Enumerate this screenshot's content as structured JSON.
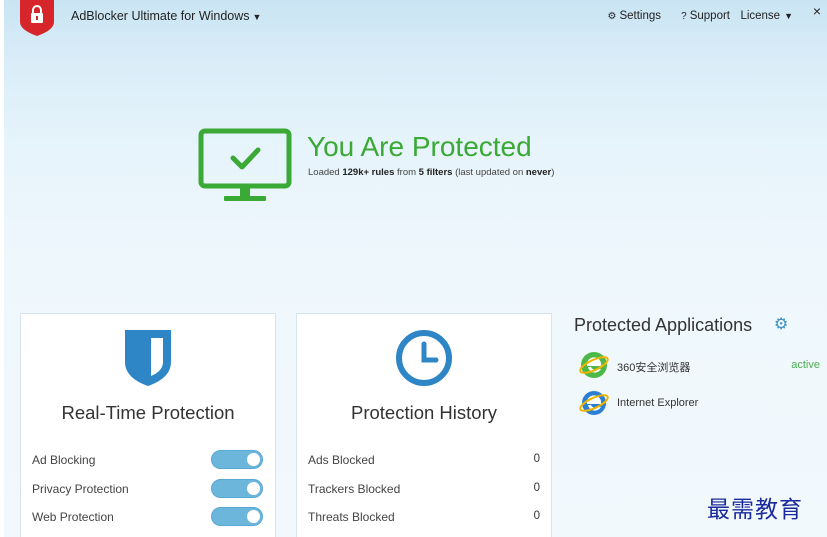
{
  "header": {
    "app_title": "AdBlocker Ultimate for Windows",
    "settings_label": "Settings",
    "support_label": "Support",
    "license_label": "License",
    "close_glyph": "×"
  },
  "hero": {
    "title": "You Are Protected",
    "sub_prefix": "Loaded ",
    "sub_rules": "129k+ rules",
    "sub_mid": " from ",
    "sub_filters": "5 filters",
    "sub_mid2": " (last updated on ",
    "sub_updated": "never",
    "sub_suffix": ")"
  },
  "realtime": {
    "title": "Real-Time Protection",
    "items": [
      {
        "label": "Ad Blocking",
        "enabled": true
      },
      {
        "label": "Privacy Protection",
        "enabled": true
      },
      {
        "label": "Web Protection",
        "enabled": true
      }
    ]
  },
  "history": {
    "title": "Protection History",
    "items": [
      {
        "label": "Ads Blocked",
        "value": "0"
      },
      {
        "label": "Trackers Blocked",
        "value": "0"
      },
      {
        "label": "Threats Blocked",
        "value": "0"
      }
    ]
  },
  "apps": {
    "title": "Protected Applications",
    "items": [
      {
        "name": "360安全浏览器",
        "status": "active",
        "icon": "browser-360-icon"
      },
      {
        "name": "Internet Explorer",
        "status": "",
        "icon": "internet-explorer-icon"
      }
    ]
  },
  "watermark": "最需教育",
  "colors": {
    "accent_green": "#3aa935",
    "accent_blue": "#3a8fc7",
    "toggle_on": "#6cb6dc",
    "logo_red": "#d7262b"
  }
}
